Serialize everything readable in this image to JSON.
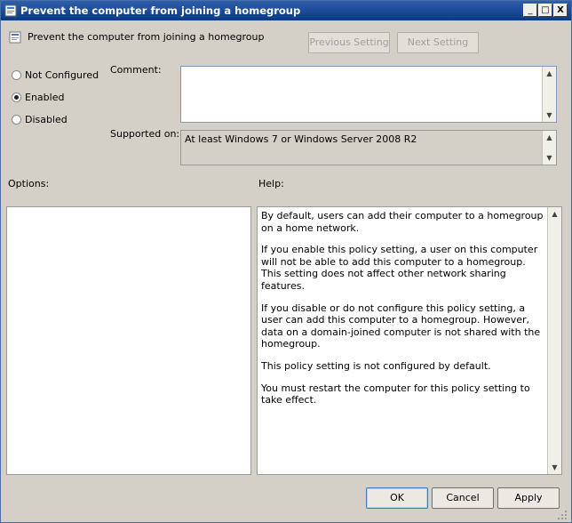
{
  "window": {
    "title": "Prevent the computer from joining a homegroup",
    "minimize_glyph": "_",
    "maximize_glyph": "□",
    "close_glyph": "X"
  },
  "header": {
    "policy_name": "Prevent the computer from joining a homegroup",
    "previous_button": "Previous Setting",
    "next_button": "Next Setting"
  },
  "state": {
    "options": [
      {
        "label": "Not Configured",
        "selected": false
      },
      {
        "label": "Enabled",
        "selected": true
      },
      {
        "label": "Disabled",
        "selected": false
      }
    ]
  },
  "comment": {
    "label": "Comment:",
    "value": ""
  },
  "supported": {
    "label": "Supported on:",
    "value": "At least Windows 7 or Windows Server 2008 R2"
  },
  "options_pane": {
    "label": "Options:"
  },
  "help_pane": {
    "label": "Help:",
    "paragraphs": [
      "By default, users can add their computer to a homegroup on a home network.",
      "If you enable this policy setting, a user on this computer will not be able to add this computer to a homegroup.  This setting does not affect other network sharing features.",
      "If you disable or do not configure this policy setting, a user can add this computer to a homegroup.  However, data on a domain-joined computer is not shared with the homegroup.",
      "This policy setting is not configured by default.",
      "You must restart the computer for this policy setting to take effect."
    ]
  },
  "footer": {
    "ok": "OK",
    "cancel": "Cancel",
    "apply": "Apply"
  }
}
